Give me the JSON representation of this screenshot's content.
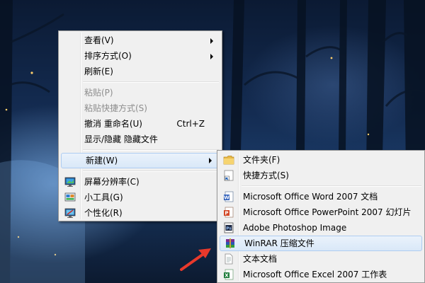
{
  "context_menu": {
    "items": [
      {
        "label": "查看(V)"
      },
      {
        "label": "排序方式(O)"
      },
      {
        "label": "刷新(E)"
      },
      {
        "label": "粘贴(P)"
      },
      {
        "label": "粘贴快捷方式(S)"
      },
      {
        "label": "撤消 重命名(U)",
        "shortcut": "Ctrl+Z"
      },
      {
        "label": "显示/隐藏 隐藏文件"
      },
      {
        "label": "新建(W)"
      },
      {
        "label": "屏幕分辨率(C)"
      },
      {
        "label": "小工具(G)"
      },
      {
        "label": "个性化(R)"
      }
    ]
  },
  "new_submenu": {
    "items": [
      {
        "label": "文件夹(F)",
        "icon": "folder-icon"
      },
      {
        "label": "快捷方式(S)",
        "icon": "shortcut-icon"
      },
      {
        "label": "Microsoft Office Word 2007 文档",
        "icon": "word-icon"
      },
      {
        "label": "Microsoft Office PowerPoint 2007 幻灯片",
        "icon": "powerpoint-icon"
      },
      {
        "label": "Adobe Photoshop Image",
        "icon": "photoshop-icon"
      },
      {
        "label": "WinRAR 压缩文件",
        "icon": "winrar-icon"
      },
      {
        "label": "文本文档",
        "icon": "text-document-icon"
      },
      {
        "label": "Microsoft Office Excel 2007 工作表",
        "icon": "excel-icon"
      }
    ]
  },
  "colors": {
    "menu_bg": "#f0f0f0",
    "highlight_border": "#aeccf1",
    "annotation_arrow": "#e8392b"
  }
}
